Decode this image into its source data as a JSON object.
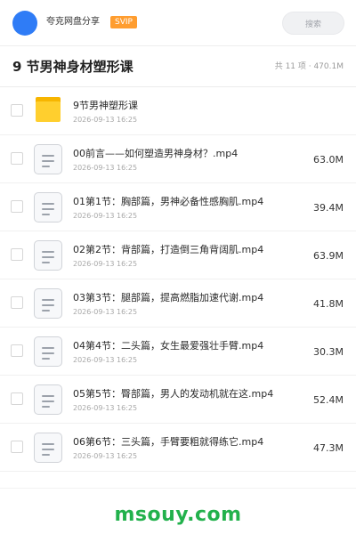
{
  "header": {
    "username": "夸克网盘分享",
    "badge": "SVIP",
    "search_placeholder": "搜索"
  },
  "folder": {
    "title": "9 节男神身材塑形课",
    "summary": "共 11 项 · 470.1M"
  },
  "items": [
    {
      "type": "folder",
      "name": "9节男神塑形课",
      "date": "2026-09-13 16:25",
      "size": ""
    },
    {
      "type": "video",
      "name": "00前言——如何塑造男神身材？.mp4",
      "date": "2026-09-13 16:25",
      "size": "63.0M"
    },
    {
      "type": "video",
      "name": "01第1节：胸部篇，男神必备性感胸肌.mp4",
      "date": "2026-09-13 16:25",
      "size": "39.4M"
    },
    {
      "type": "video",
      "name": "02第2节：背部篇，打造倒三角背阔肌.mp4",
      "date": "2026-09-13 16:25",
      "size": "63.9M"
    },
    {
      "type": "video",
      "name": "03第3节：腿部篇，提高燃脂加速代谢.mp4",
      "date": "2026-09-13 16:25",
      "size": "41.8M"
    },
    {
      "type": "video",
      "name": "04第4节：二头篇，女生最爱强壮手臂.mp4",
      "date": "2026-09-13 16:25",
      "size": "30.3M"
    },
    {
      "type": "video",
      "name": "05第5节：臀部篇，男人的发动机就在这.mp4",
      "date": "2026-09-13 16:25",
      "size": "52.4M"
    },
    {
      "type": "video",
      "name": "06第6节：三头篇，手臂要粗就得练它.mp4",
      "date": "2026-09-13 16:25",
      "size": "47.3M"
    }
  ],
  "footer": {
    "watermark": "msouy.com"
  },
  "colors": {
    "accent": "#2f7cf6",
    "svip": "#ff9d2f",
    "folder": "#ffcf2e",
    "watermark": "#22b14c"
  }
}
